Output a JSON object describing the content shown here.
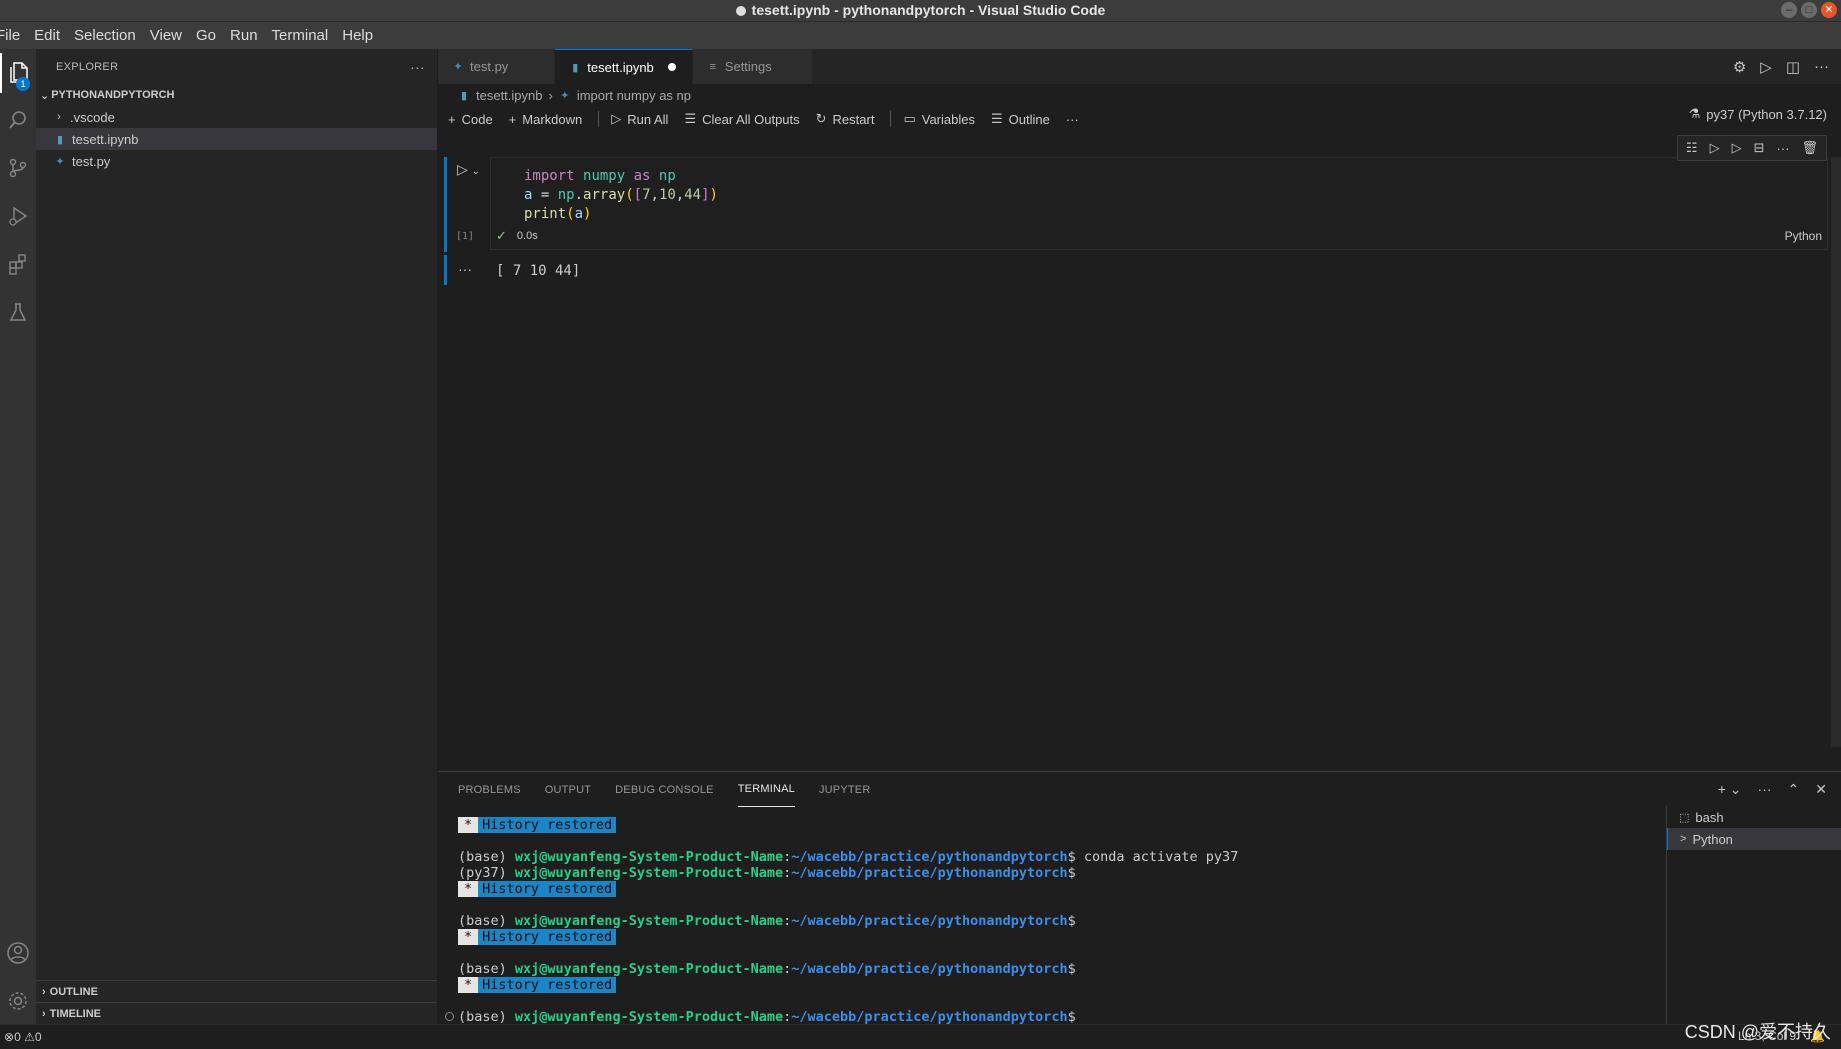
{
  "window": {
    "title": "tesett.ipynb - pythonandpytorch - Visual Studio Code"
  },
  "menu": [
    "File",
    "Edit",
    "Selection",
    "View",
    "Go",
    "Run",
    "Terminal",
    "Help"
  ],
  "activity": {
    "explorer_badge": "1"
  },
  "explorer": {
    "header": "EXPLORER",
    "folder": "PYTHONANDPYTORCH",
    "items": [
      {
        "label": ".vscode"
      },
      {
        "label": "tesett.ipynb"
      },
      {
        "label": "test.py"
      }
    ],
    "outline": "OUTLINE",
    "timeline": "TIMELINE"
  },
  "tabs": [
    {
      "label": "test.py"
    },
    {
      "label": "tesett.ipynb"
    },
    {
      "label": "Settings"
    }
  ],
  "breadcrumb": {
    "file": "tesett.ipynb",
    "symbol": "import numpy as np"
  },
  "toolbar": {
    "code": "Code",
    "markdown": "Markdown",
    "run_all": "Run All",
    "clear_outputs": "Clear All Outputs",
    "restart": "Restart",
    "variables": "Variables",
    "outline": "Outline",
    "kernel": "py37 (Python 3.7.12)"
  },
  "cell": {
    "code_lines": [
      "import numpy as np",
      "a = np.array([7,10,44])",
      "print(a)"
    ],
    "exec_count": "[1]",
    "duration": "0.0s",
    "language": "Python",
    "output": "[ 7 10 44]"
  },
  "panel": {
    "tabs": [
      "PROBLEMS",
      "OUTPUT",
      "DEBUG CONSOLE",
      "TERMINAL",
      "JUPYTER"
    ],
    "history_label": "History restored",
    "prompt_user": "wxj@wuyanfeng-System-Product-Name",
    "prompt_path": "~/wacebb/practice/pythonandpytorch",
    "base": "(base)",
    "py37": "(py37)",
    "command": "conda activate py37",
    "terminals": [
      {
        "label": "bash"
      },
      {
        "label": "Python"
      }
    ]
  },
  "statusbar": {
    "errors": "0",
    "warnings": "0",
    "position": "Ln 3, Col 9"
  },
  "watermark": "CSDN @爱不持久"
}
